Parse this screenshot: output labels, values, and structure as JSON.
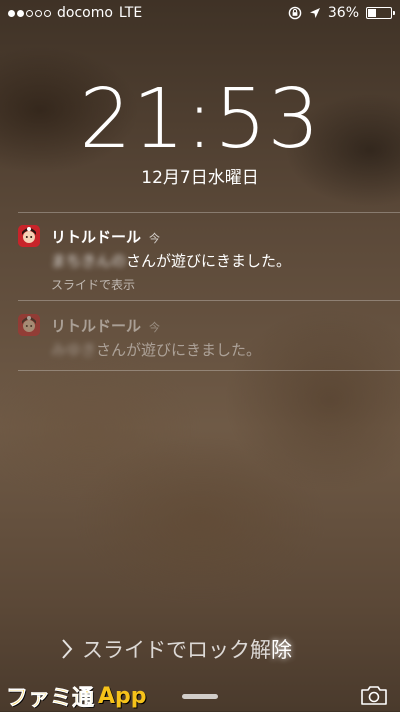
{
  "status_bar": {
    "carrier": "docomo",
    "network": "LTE",
    "battery_percent": "36%",
    "battery_level": 0.36,
    "signal_bars_filled": 2,
    "signal_bars_total": 5
  },
  "lock_screen": {
    "time": "21:53",
    "date": "12月7日水曜日"
  },
  "notifications": [
    {
      "app_name": "リトルドール",
      "time": "今",
      "sender_blurred": "まちきんの",
      "message": "さんが遊びにきました。",
      "action": "スライドで表示",
      "icon": "little-doll-app-icon"
    },
    {
      "app_name": "リトルドール",
      "time": "今",
      "sender_blurred": "みゆき",
      "message": "さんが遊びにきました。",
      "icon": "little-doll-app-icon"
    }
  ],
  "slide_to_unlock": {
    "text_main": "スライドでロック解",
    "text_glow": "除"
  },
  "watermark": {
    "jp": "ファミ通",
    "app": "App"
  },
  "colors": {
    "app_icon_red": "#c8242a",
    "watermark_yellow": "#f6c21a"
  }
}
